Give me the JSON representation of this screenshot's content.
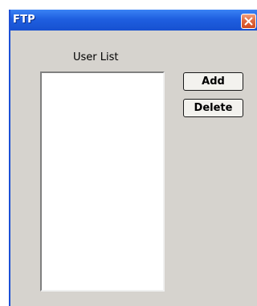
{
  "window": {
    "title": "FTP"
  },
  "user_list": {
    "label": "User List",
    "items": []
  },
  "buttons": {
    "add_label": "Add",
    "delete_label": "Delete"
  },
  "colors": {
    "titlebar": "#1f5fe0",
    "window_background": "#d6d3ce",
    "close_button": "#e06a40"
  },
  "icons": {
    "close": "close-icon"
  }
}
